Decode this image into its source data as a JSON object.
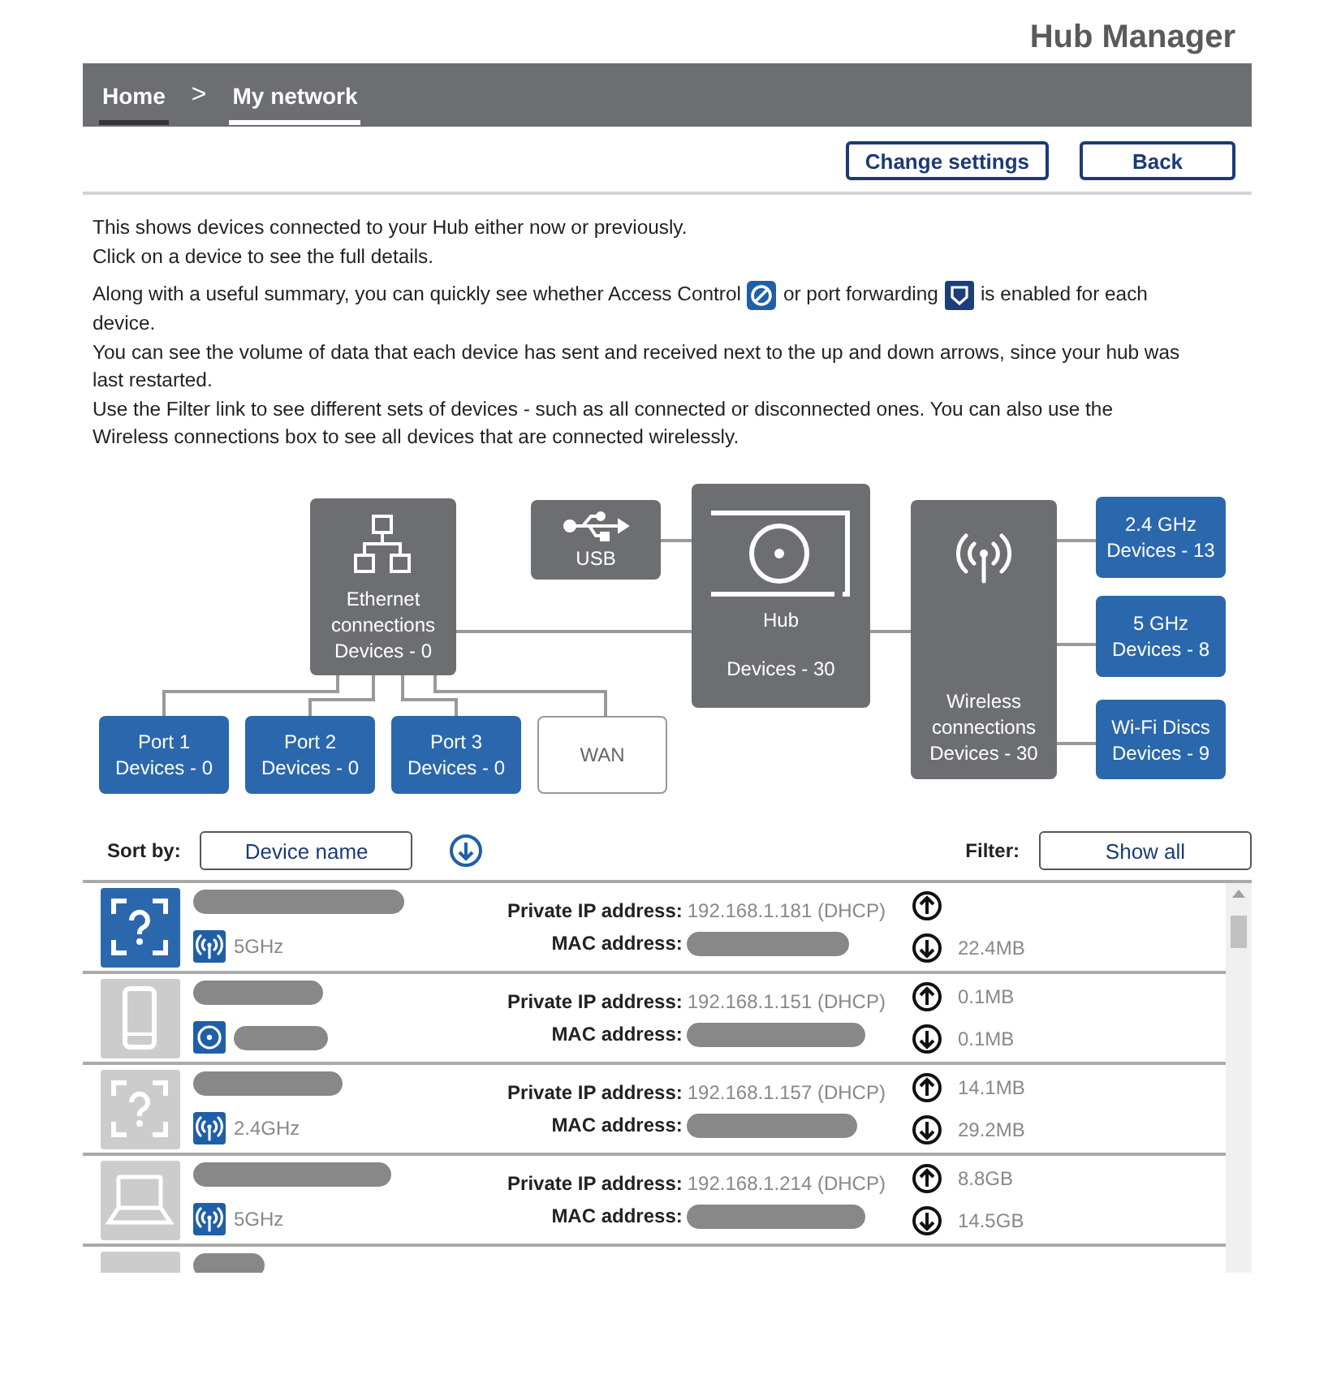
{
  "app_title": "Hub Manager",
  "breadcrumbs": [
    {
      "label": "Home",
      "selected": false
    },
    {
      "label": "My network",
      "selected": true
    }
  ],
  "breadcrumb_separator": ">",
  "buttons": [
    "Change settings",
    "Back"
  ],
  "intro": [
    {
      "parts": [
        "This shows devices connected to your Hub either now or previously."
      ]
    },
    {
      "parts": [
        "Click on a device to see the full details."
      ]
    },
    {
      "parts": [
        "Along with a useful summary, you can quickly see whether Access Control",
        {
          "kind": "access-control"
        },
        "or port forwarding",
        {
          "kind": "port-forwarding"
        },
        "is enabled for each",
        "device."
      ]
    },
    {
      "parts": [
        "You can see the volume of data that each device has sent and received next to the up and down arrows, since your hub was last restarted."
      ]
    },
    {
      "parts": [
        "Use the Filter link to see different sets of devices - such as all connected or disconnected ones. You can also use the Wireless connections box to see all devices that are connected wirelessly."
      ]
    }
  ],
  "diagram": {
    "nodes": [
      {
        "kind": "ethernet",
        "lines": [
          "Ethernet",
          "connections",
          "Devices - 0"
        ]
      },
      {
        "kind": "usb",
        "lines": [
          "USB"
        ]
      },
      {
        "kind": "hub",
        "lines": [
          "Hub",
          "Devices - 30"
        ]
      },
      {
        "kind": "wireless",
        "lines": [
          "Wireless",
          "connections",
          "Devices - 30"
        ]
      },
      {
        "kind": "band",
        "lines": [
          "2.4 GHz",
          "Devices - 13"
        ]
      },
      {
        "kind": "band",
        "lines": [
          "5 GHz",
          "Devices - 8"
        ]
      },
      {
        "kind": "band",
        "lines": [
          "Wi-Fi Discs",
          "Devices - 9"
        ]
      },
      {
        "kind": "port",
        "lines": [
          "Port 1",
          "Devices - 0"
        ]
      },
      {
        "kind": "port",
        "lines": [
          "Port 2",
          "Devices - 0"
        ]
      },
      {
        "kind": "port",
        "lines": [
          "Port 3",
          "Devices - 0"
        ]
      },
      {
        "kind": "wan",
        "lines": [
          "WAN"
        ]
      }
    ]
  },
  "sort": {
    "label": "Sort by:",
    "value": "Device name"
  },
  "filter": {
    "label": "Filter:",
    "value": "Show all"
  },
  "devices": [
    {
      "kind": "unknown",
      "connected": true,
      "connection": {
        "kind": "wifi",
        "band": "5GHz"
      },
      "ip_label": "Private IP address:",
      "ip": "192.168.1.181 (DHCP)",
      "mac_label": "MAC address:",
      "download": "22.4MB"
    },
    {
      "kind": "phone",
      "connected": false,
      "connection": {
        "kind": "disc"
      },
      "ip_label": "Private IP address:",
      "ip": "192.168.1.151 (DHCP)",
      "mac_label": "MAC address:",
      "upload": "0.1MB",
      "download": "0.1MB"
    },
    {
      "kind": "unknown",
      "connected": false,
      "connection": {
        "kind": "wifi",
        "band": "2.4GHz"
      },
      "ip_label": "Private IP address:",
      "ip": "192.168.1.157 (DHCP)",
      "mac_label": "MAC address:",
      "upload": "14.1MB",
      "download": "29.2MB"
    },
    {
      "kind": "laptop",
      "connected": false,
      "connection": {
        "kind": "wifi",
        "band": "5GHz"
      },
      "ip_label": "Private IP address:",
      "ip": "192.168.1.214 (DHCP)",
      "mac_label": "MAC address:",
      "upload": "8.8GB",
      "download": "14.5GB"
    },
    {
      "kind": "blank",
      "connected": false
    }
  ]
}
